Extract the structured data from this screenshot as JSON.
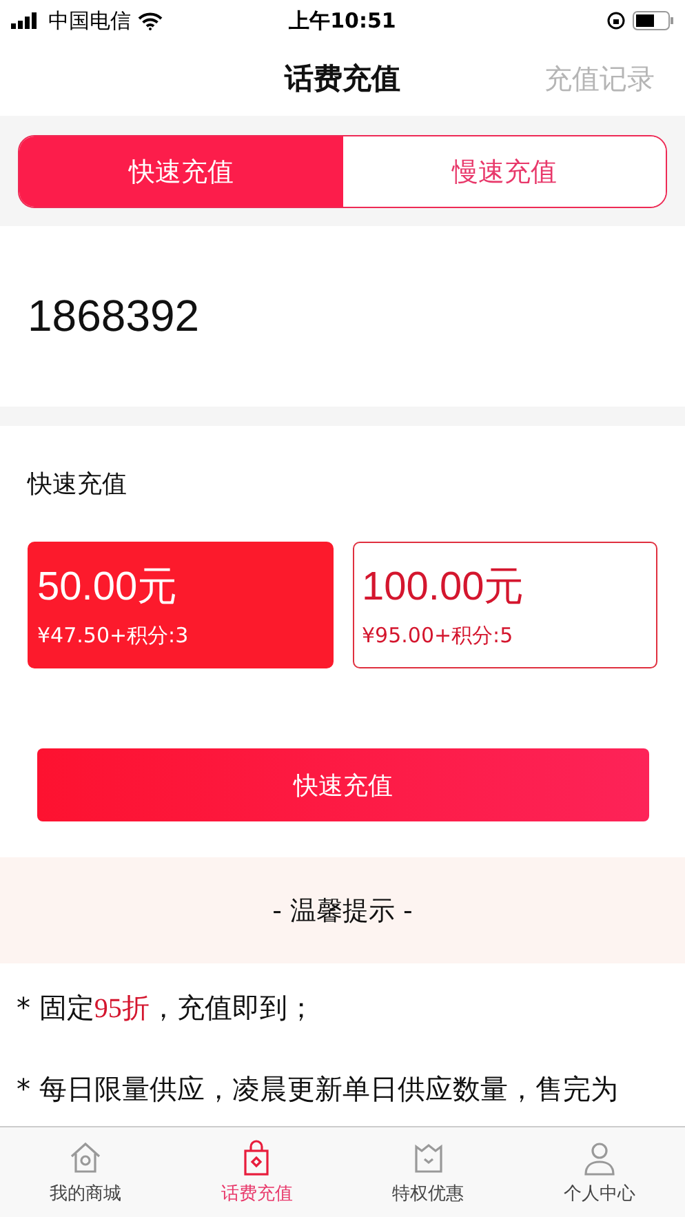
{
  "status_bar": {
    "carrier": "中国电信",
    "time": "上午10:51"
  },
  "nav": {
    "title": "话费充值",
    "action": "充值记录"
  },
  "segments": [
    {
      "label": "快速充值",
      "selected": true
    },
    {
      "label": "慢速充值",
      "selected": false
    }
  ],
  "phone": {
    "value": "1868392"
  },
  "section": {
    "title": "快速充值"
  },
  "options": [
    {
      "amount": "50.00元",
      "detail": "¥47.50+积分:3",
      "selected": true
    },
    {
      "amount": "100.00元",
      "detail": "¥95.00+积分:5",
      "selected": false
    }
  ],
  "submit": {
    "label": "快速充值"
  },
  "notice": {
    "title": "- 温馨提示 -"
  },
  "notes": [
    "* 固定**95折**，充值即到；",
    "* 每日限量供应，凌晨更新单日供应数量，售完为"
  ],
  "tabs": [
    {
      "label": "我的商城",
      "kind": "home",
      "selected": false
    },
    {
      "label": "话费充值",
      "kind": "bag",
      "selected": true
    },
    {
      "label": "特权优惠",
      "kind": "crown",
      "selected": false
    },
    {
      "label": "个人中心",
      "kind": "person",
      "selected": false
    }
  ]
}
